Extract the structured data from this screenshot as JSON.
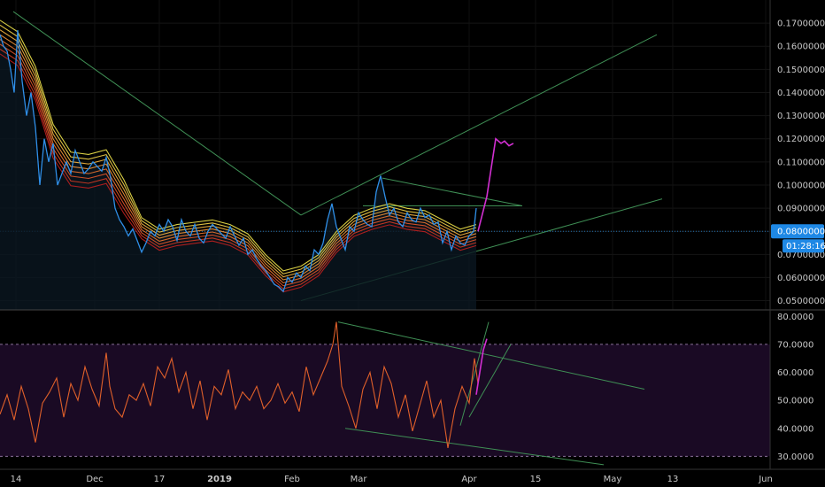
{
  "colors": {
    "background": "#000000",
    "price_line": "#2f8fe8",
    "ribbon_slow": "#d2282a",
    "ribbon_fast": "#f0e44a",
    "trendline": "#3f8f55",
    "projection": "#d22fd2",
    "rsi_line": "#e0602a",
    "rsi_band": "#1a0a24",
    "rsi_level_line": "#8a6f9a",
    "price_marker_line": "#1f6fb0",
    "badge_bg": "#1e88e5",
    "badge_text": "#ffffff"
  },
  "price_badge": {
    "value": "0.0800000",
    "countdown": "01:28:16"
  },
  "chart_data": [
    {
      "type": "line",
      "xaxis": {
        "ticks": [
          "14",
          "Dec",
          "17",
          "2019",
          "Feb",
          "Mar",
          "Apr",
          "15",
          "May",
          "13",
          "Jun"
        ],
        "bold_ticks": [
          "2019"
        ]
      },
      "yaxis": {
        "ticks": [
          "0.1700000",
          "0.1600000",
          "0.1500000",
          "0.1400000",
          "0.1300000",
          "0.1200000",
          "0.1100000",
          "0.1000000",
          "0.0900000",
          "0.0800000",
          "0.0700000",
          "0.0600000",
          "0.0500000"
        ],
        "ylim": [
          0.046,
          0.18
        ]
      },
      "grid": true,
      "series": [
        {
          "key": "price",
          "x": [
            0,
            4,
            8,
            12,
            16,
            20,
            25,
            30,
            35,
            40,
            45,
            50,
            55,
            60,
            65,
            70,
            75,
            80,
            85,
            90,
            95,
            100,
            105,
            110,
            115,
            120,
            125,
            130,
            135,
            140,
            145,
            150,
            155,
            160,
            165,
            170,
            175,
            180,
            185,
            190,
            195,
            200,
            205,
            210,
            215,
            220,
            225,
            230,
            235,
            240,
            245,
            250,
            255,
            260,
            265,
            270,
            275,
            280,
            285,
            290,
            295,
            300,
            305,
            310,
            315,
            320,
            325,
            330,
            335,
            340,
            345,
            350,
            355,
            360,
            365,
            370,
            375,
            380,
            385,
            390,
            395,
            400,
            405,
            410,
            415,
            420,
            425,
            430,
            435,
            440,
            445,
            450,
            455,
            460,
            465,
            470,
            475,
            480,
            485,
            490,
            495,
            500,
            505,
            510,
            515,
            520,
            525,
            530,
            535,
            538
          ],
          "y": [
            0.165,
            0.16,
            0.158,
            0.15,
            0.14,
            0.167,
            0.145,
            0.13,
            0.14,
            0.125,
            0.1,
            0.12,
            0.11,
            0.118,
            0.1,
            0.105,
            0.11,
            0.105,
            0.115,
            0.11,
            0.105,
            0.107,
            0.11,
            0.108,
            0.106,
            0.112,
            0.103,
            0.09,
            0.085,
            0.082,
            0.078,
            0.081,
            0.076,
            0.071,
            0.075,
            0.08,
            0.078,
            0.083,
            0.08,
            0.085,
            0.082,
            0.076,
            0.085,
            0.08,
            0.078,
            0.083,
            0.077,
            0.075,
            0.08,
            0.083,
            0.081,
            0.079,
            0.077,
            0.082,
            0.078,
            0.074,
            0.077,
            0.07,
            0.072,
            0.068,
            0.065,
            0.063,
            0.06,
            0.057,
            0.056,
            0.054,
            0.06,
            0.058,
            0.062,
            0.06,
            0.065,
            0.063,
            0.072,
            0.07,
            0.075,
            0.085,
            0.092,
            0.082,
            0.077,
            0.072,
            0.082,
            0.08,
            0.088,
            0.085,
            0.083,
            0.082,
            0.097,
            0.104,
            0.095,
            0.087,
            0.09,
            0.084,
            0.082,
            0.088,
            0.085,
            0.084,
            0.09,
            0.086,
            0.087,
            0.083,
            0.084,
            0.075,
            0.08,
            0.072,
            0.078,
            0.075,
            0.074,
            0.078,
            0.08,
            0.09
          ]
        },
        {
          "key": "ribbon",
          "name": "",
          "x": [
            0,
            20,
            40,
            60,
            80,
            100,
            120,
            140,
            160,
            180,
            200,
            220,
            240,
            260,
            280,
            300,
            320,
            340,
            360,
            380,
            400,
            420,
            440,
            460,
            480,
            500,
            520,
            538
          ],
          "y": [
            0.165,
            0.16,
            0.145,
            0.12,
            0.108,
            0.107,
            0.109,
            0.096,
            0.082,
            0.077,
            0.079,
            0.08,
            0.081,
            0.079,
            0.075,
            0.066,
            0.059,
            0.061,
            0.066,
            0.076,
            0.083,
            0.086,
            0.088,
            0.086,
            0.085,
            0.081,
            0.077,
            0.079
          ]
        },
        {
          "key": "projection",
          "x": [
            540,
            550,
            556,
            560,
            566,
            570,
            575,
            580
          ],
          "y": [
            0.08,
            0.095,
            0.11,
            0.12,
            0.118,
            0.119,
            0.117,
            0.118
          ]
        }
      ],
      "trendlines": [
        {
          "from": [
            15,
            0.175
          ],
          "to": [
            340,
            0.087
          ]
        },
        {
          "from": [
            340,
            0.087
          ],
          "to": [
            742,
            0.165
          ]
        },
        {
          "from": [
            340,
            0.05
          ],
          "to": [
            748,
            0.094
          ]
        },
        {
          "from": [
            432,
            0.103
          ],
          "to": [
            590,
            0.091
          ]
        },
        {
          "from": [
            410,
            0.091
          ],
          "to": [
            590,
            0.091
          ]
        }
      ],
      "current_price_line": 0.08
    },
    {
      "type": "line",
      "yaxis": {
        "ticks": [
          "80.0000",
          "70.0000",
          "60.0000",
          "50.0000",
          "40.0000",
          "30.0000"
        ],
        "ylim": [
          26,
          82
        ]
      },
      "levels": [
        70,
        30
      ],
      "series": [
        {
          "key": "rsi",
          "x": [
            0,
            8,
            16,
            24,
            32,
            40,
            48,
            56,
            64,
            72,
            80,
            88,
            96,
            104,
            112,
            120,
            124,
            130,
            138,
            146,
            154,
            162,
            170,
            178,
            186,
            194,
            202,
            210,
            218,
            226,
            234,
            242,
            250,
            258,
            266,
            274,
            282,
            290,
            298,
            306,
            314,
            322,
            330,
            338,
            346,
            354,
            362,
            370,
            376,
            380,
            386,
            394,
            402,
            410,
            418,
            426,
            434,
            442,
            450,
            458,
            466,
            474,
            482,
            490,
            498,
            506,
            514,
            522,
            530,
            536,
            540
          ],
          "y": [
            45,
            52,
            43,
            55,
            47,
            35,
            49,
            53,
            58,
            44,
            56,
            50,
            62,
            54,
            48,
            67,
            55,
            47,
            44,
            52,
            50,
            56,
            48,
            62,
            58,
            65,
            53,
            60,
            47,
            57,
            43,
            55,
            52,
            61,
            47,
            53,
            50,
            55,
            47,
            50,
            56,
            49,
            53,
            46,
            62,
            52,
            58,
            64,
            70,
            78,
            55,
            48,
            40,
            54,
            60,
            47,
            62,
            56,
            44,
            52,
            39,
            48,
            57,
            44,
            50,
            33,
            47,
            55,
            49,
            65,
            56
          ]
        },
        {
          "key": "rsi_projection",
          "x": [
            538,
            542,
            546,
            550
          ],
          "y": [
            52,
            60,
            68,
            72
          ]
        }
      ],
      "trendlines": [
        {
          "from": [
            382,
            78
          ],
          "to": [
            728,
            54
          ]
        },
        {
          "from": [
            390,
            40
          ],
          "to": [
            682,
            27
          ]
        },
        {
          "from": [
            520,
            41
          ],
          "to": [
            552,
            78
          ]
        },
        {
          "from": [
            530,
            44
          ],
          "to": [
            577,
            70
          ]
        }
      ]
    }
  ]
}
